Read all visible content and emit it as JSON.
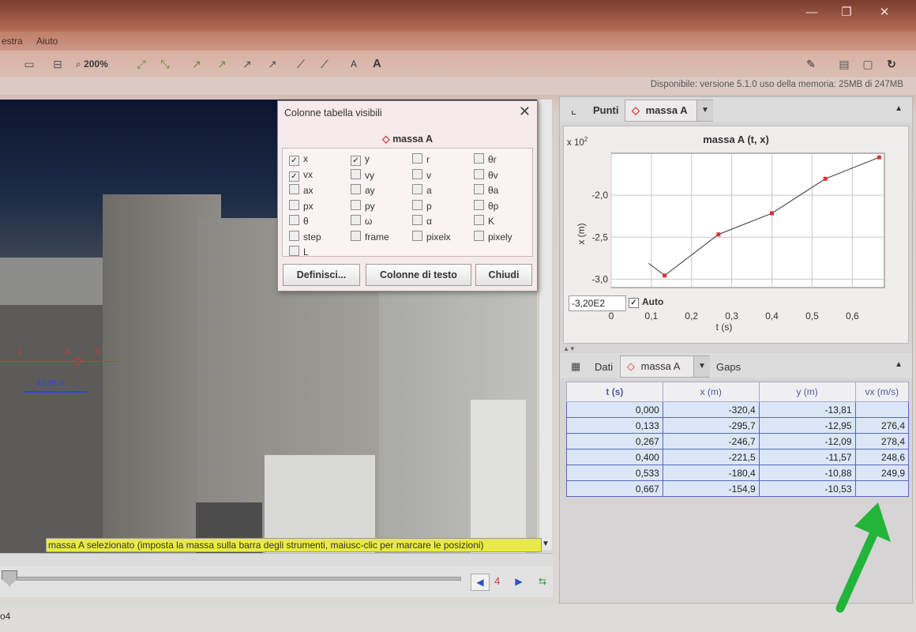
{
  "menubar": {
    "items": [
      "estra",
      "Aiuto"
    ]
  },
  "toolbar": {
    "zoom_label": "200%",
    "font_small": "A",
    "font_large": "A"
  },
  "memory_line": "Disponibile: versione 5.1.0   uso della memoria: 25MB di 247MB",
  "video": {
    "marker_numbers": [
      "1",
      "4",
      "5"
    ],
    "scale_label": "43,00 m",
    "status_text": "massa A selezionato (imposta la massa sulla barra degli strumenti, maiusc-clic per marcare le posizioni)",
    "frame_number": "4"
  },
  "bottom_bar": {
    "left_text": "o4"
  },
  "dialog": {
    "title": "Colonne tabella visibili",
    "mass_label": "massa A",
    "checkboxes": [
      {
        "label": "x",
        "checked": true
      },
      {
        "label": "y",
        "checked": true
      },
      {
        "label": "r",
        "checked": false
      },
      {
        "label": "θr",
        "checked": false
      },
      {
        "label": "vx",
        "checked": true
      },
      {
        "label": "vy",
        "checked": false
      },
      {
        "label": "v",
        "checked": false
      },
      {
        "label": "θv",
        "checked": false
      },
      {
        "label": "ax",
        "checked": false
      },
      {
        "label": "ay",
        "checked": false
      },
      {
        "label": "a",
        "checked": false
      },
      {
        "label": "θa",
        "checked": false
      },
      {
        "label": "px",
        "checked": false
      },
      {
        "label": "py",
        "checked": false
      },
      {
        "label": "p",
        "checked": false
      },
      {
        "label": "θp",
        "checked": false
      },
      {
        "label": "θ",
        "checked": false
      },
      {
        "label": "ω",
        "checked": false
      },
      {
        "label": "α",
        "checked": false
      },
      {
        "label": "K",
        "checked": false
      },
      {
        "label": "step",
        "checked": false
      },
      {
        "label": "frame",
        "checked": false
      },
      {
        "label": "pixelx",
        "checked": false
      },
      {
        "label": "pixely",
        "checked": false
      },
      {
        "label": "L",
        "checked": false
      }
    ],
    "buttons": {
      "definisci": "Definisci...",
      "colonne_testo": "Colonne di testo",
      "chiudi": "Chiudi"
    }
  },
  "plot_panel": {
    "label": "Punti",
    "mass_combo": "massa A",
    "auto_value": "-3,20E2",
    "auto_label": "Auto"
  },
  "chart_data": {
    "type": "line",
    "title": "massa A (t, x)",
    "xlabel": "t (s)",
    "ylabel": "x (m)",
    "y_multiplier": "x 10",
    "y_multiplier_exp": "2",
    "x": [
      0.133,
      0.267,
      0.4,
      0.533,
      0.667
    ],
    "y": [
      -2.957,
      -2.467,
      -2.215,
      -1.804,
      -1.549
    ],
    "xlim": [
      0,
      0.68
    ],
    "ylim": [
      -3.1,
      -1.5
    ],
    "x_ticks": [
      "0",
      "0,1",
      "0,2",
      "0,3",
      "0,4",
      "0,5",
      "0,6"
    ],
    "x_tick_values": [
      0,
      0.1,
      0.2,
      0.3,
      0.4,
      0.5,
      0.6
    ],
    "y_ticks": [
      "-3,0",
      "-2,5",
      "-2,0"
    ],
    "y_tick_values": [
      -3.0,
      -2.5,
      -2.0
    ],
    "grid": true,
    "line_color": "#333333",
    "point_color": "#d9333a"
  },
  "data_panel": {
    "label": "Dati",
    "mass_combo": "massa A",
    "gaps_label": "Gaps",
    "columns": [
      "t (s)",
      "x (m)",
      "y (m)",
      "vx (m/s)"
    ],
    "rows": [
      [
        "0,000",
        "-320,4",
        "-13,81",
        ""
      ],
      [
        "0,133",
        "-295,7",
        "-12,95",
        "276,4"
      ],
      [
        "0,267",
        "-246,7",
        "-12,09",
        "278,4"
      ],
      [
        "0,400",
        "-221,5",
        "-11,57",
        "248,6"
      ],
      [
        "0,533",
        "-180,4",
        "-10,88",
        "249,9"
      ],
      [
        "0,667",
        "-154,9",
        "-10,53",
        ""
      ]
    ]
  },
  "colors": {
    "accent_red": "#d9333a",
    "status_yellow": "#eaea44",
    "arrow_green": "#23b43a"
  }
}
